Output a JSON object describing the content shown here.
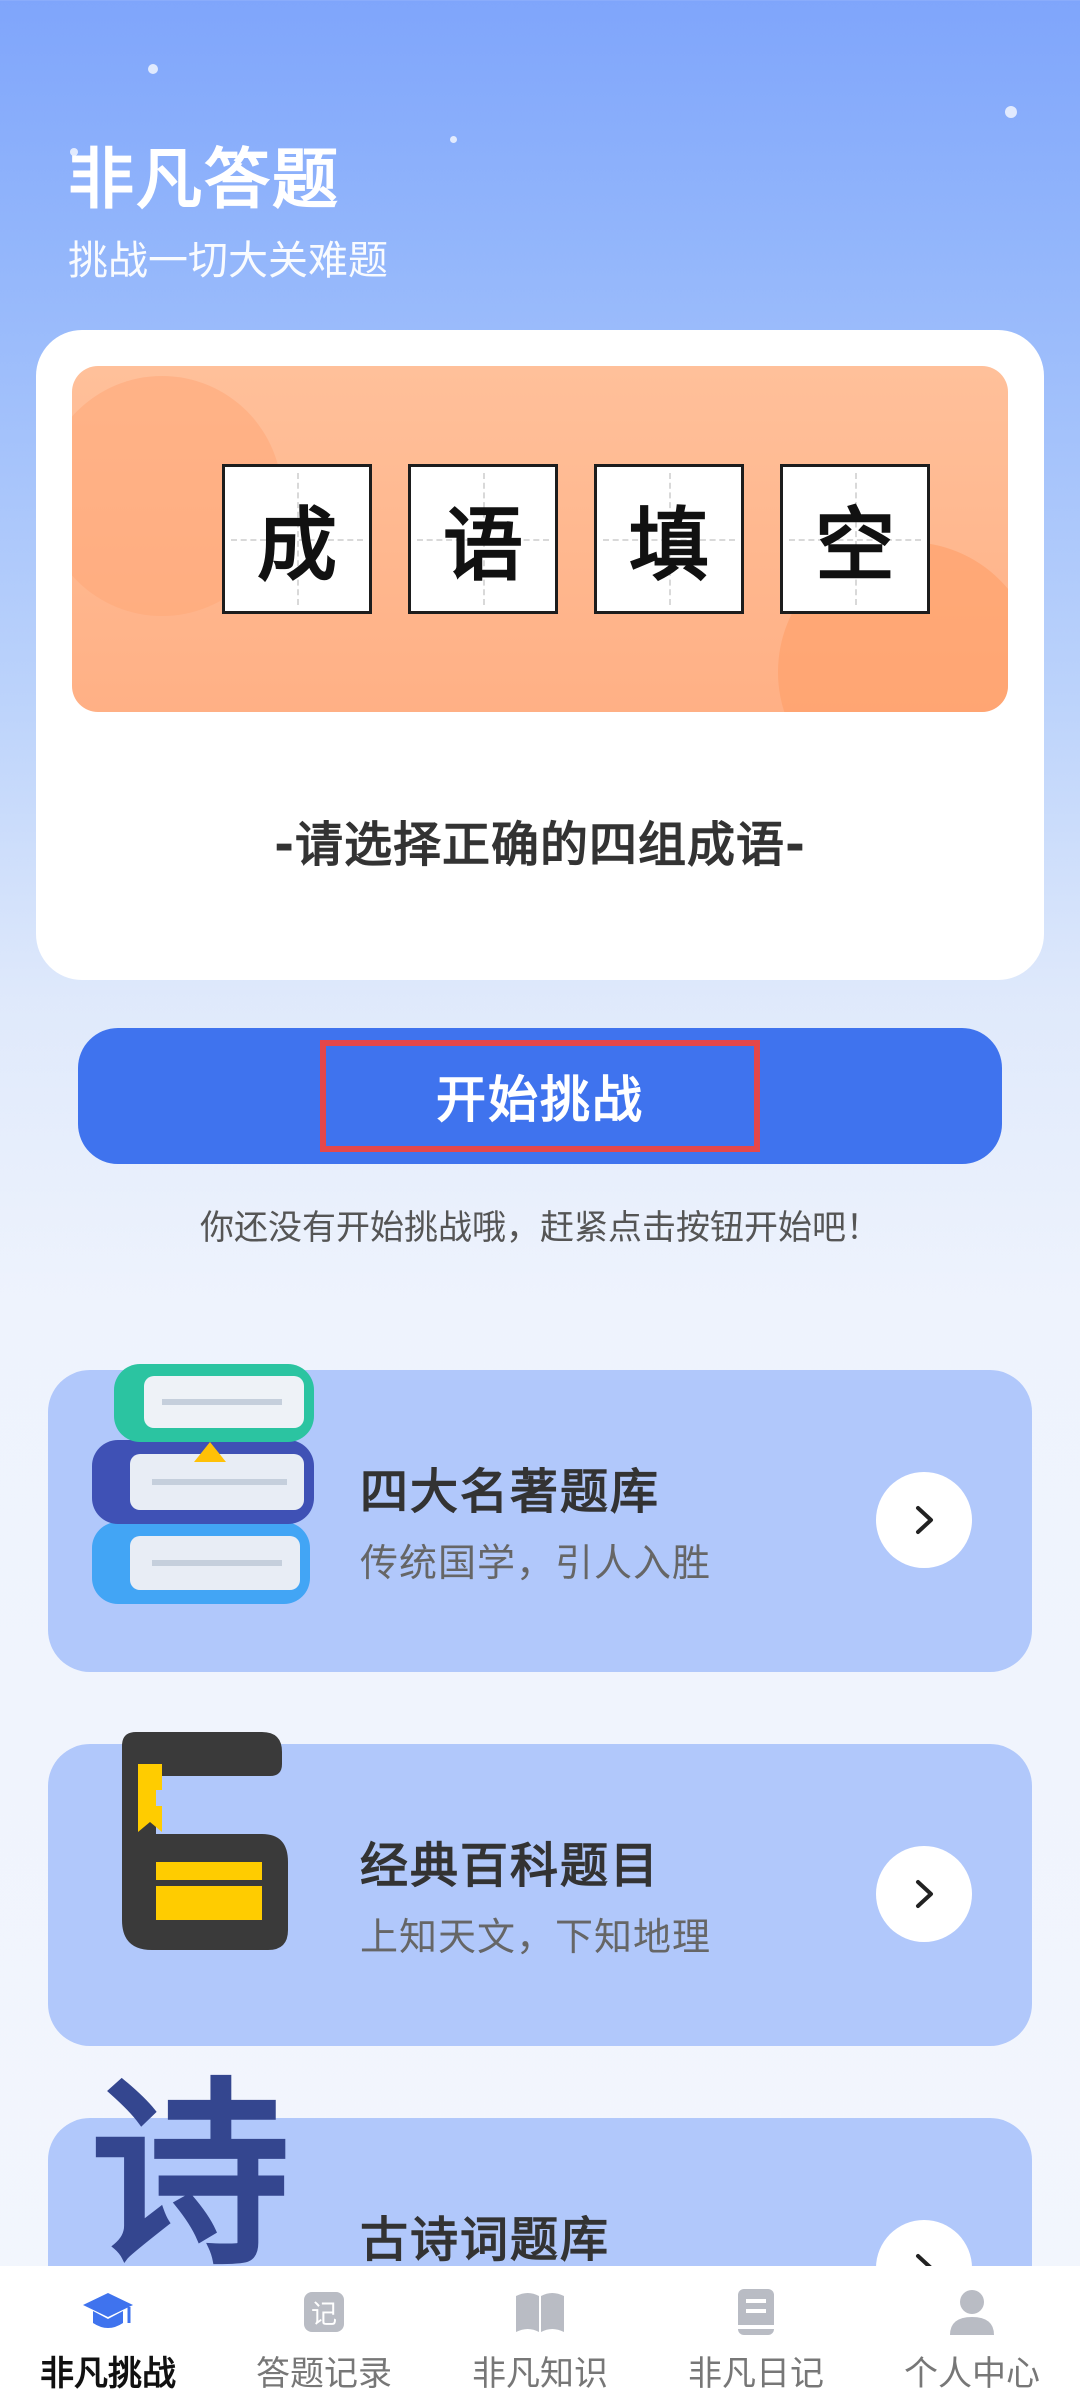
{
  "header": {
    "title": "非凡答题",
    "subtitle": "挑战一切大关难题"
  },
  "hero": {
    "chars": [
      "成",
      "语",
      "填",
      "空"
    ],
    "tagline": "-请选择正确的四组成语-"
  },
  "start": {
    "button_label": "开始挑战",
    "hint": "你还没有开始挑战哦，赶紧点击按钮开始吧！"
  },
  "categories": [
    {
      "title": "四大名著题库",
      "subtitle": "传统国学，引人入胜",
      "icon": "books-stack-icon"
    },
    {
      "title": "经典百科题目",
      "subtitle": "上知天文，下知地理",
      "icon": "open-book-icon"
    },
    {
      "title": "古诗词题库",
      "subtitle": "",
      "icon": "poem-character-icon",
      "icon_text": "诗"
    }
  ],
  "tabbar": {
    "items": [
      {
        "label": "非凡挑战",
        "icon": "graduation-cap-icon",
        "active": true
      },
      {
        "label": "答题记录",
        "icon": "record-icon",
        "icon_text": "记",
        "active": false
      },
      {
        "label": "非凡知识",
        "icon": "book-icon",
        "active": false
      },
      {
        "label": "非凡日记",
        "icon": "diary-icon",
        "active": false
      },
      {
        "label": "个人中心",
        "icon": "person-icon",
        "active": false
      }
    ]
  },
  "colors": {
    "primary": "#3f73ee",
    "card_blue": "#b1c8fb",
    "banner_orange": "#ffb085"
  }
}
